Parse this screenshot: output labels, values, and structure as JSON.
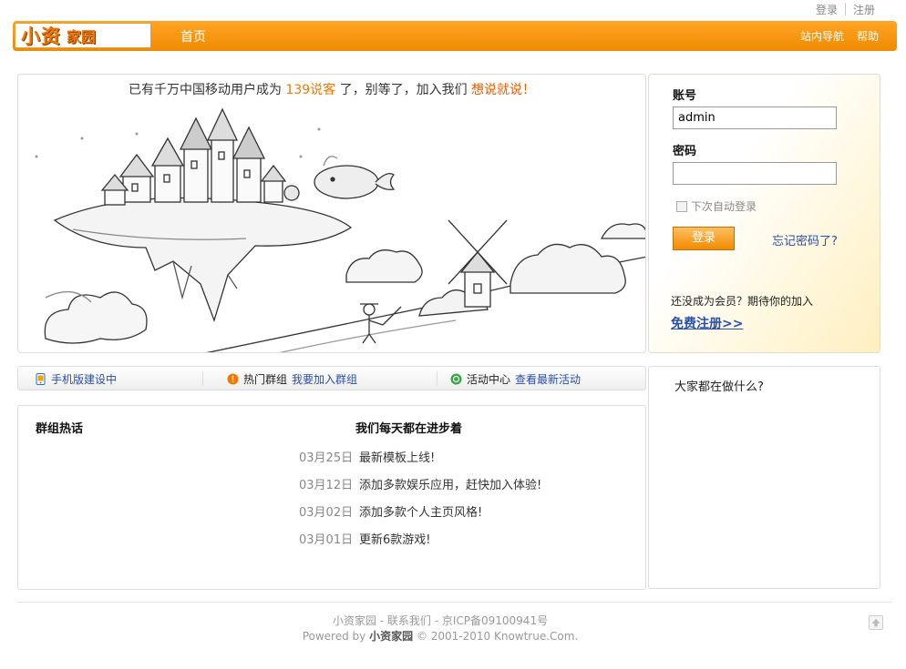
{
  "top_links": {
    "login": "登录",
    "register": "注册"
  },
  "logo": {
    "big": "小资",
    "small": "家园"
  },
  "nav": {
    "home": "首页",
    "site_nav": "站内导航",
    "help": "帮助"
  },
  "banner": {
    "tagline_prefix": "已有千万中国移动用户成为",
    "tagline_highlight": "139说客",
    "tagline_middle": "了，别等了，加入我们",
    "tagline_cta": "想说就说！"
  },
  "login": {
    "account_label": "账号",
    "account_value": "admin",
    "password_label": "密码",
    "password_value": "",
    "remember_label": "下次自动登录",
    "login_button": "登录",
    "forgot_link": "忘记密码了?",
    "not_member_text": "还没成为会员？期待你的加入",
    "register_link": "免费注册>>"
  },
  "tabs": {
    "mobile": "手机版建设中",
    "hot_groups_label": "热门群组",
    "join_group_link": "我要加入群组",
    "activity_label": "活动中心",
    "latest_activity_link": "查看最新活动"
  },
  "activity_box": {
    "title": "大家都在做什么?"
  },
  "groups_box": {
    "title": "群组热话"
  },
  "news": {
    "title": "我们每天都在进步着",
    "items": [
      {
        "date": "03月25日",
        "text": "最新模板上线!"
      },
      {
        "date": "03月12日",
        "text": "添加多款娱乐应用，赶快加入体验!"
      },
      {
        "date": "03月02日",
        "text": "添加多款个人主页风格!"
      },
      {
        "date": "03月01日",
        "text": "更新6款游戏!"
      }
    ]
  },
  "footer": {
    "line1": "小资家园 - 联系我们 - 京ICP备09100941号",
    "powered_prefix": "Powered by",
    "powered_brand": "小资家园",
    "copyright": "© 2001-2010 Knowtrue.Com."
  },
  "colors": {
    "accent": "#f08a00",
    "link": "#2a4fa6",
    "highlight": "#f07800"
  }
}
